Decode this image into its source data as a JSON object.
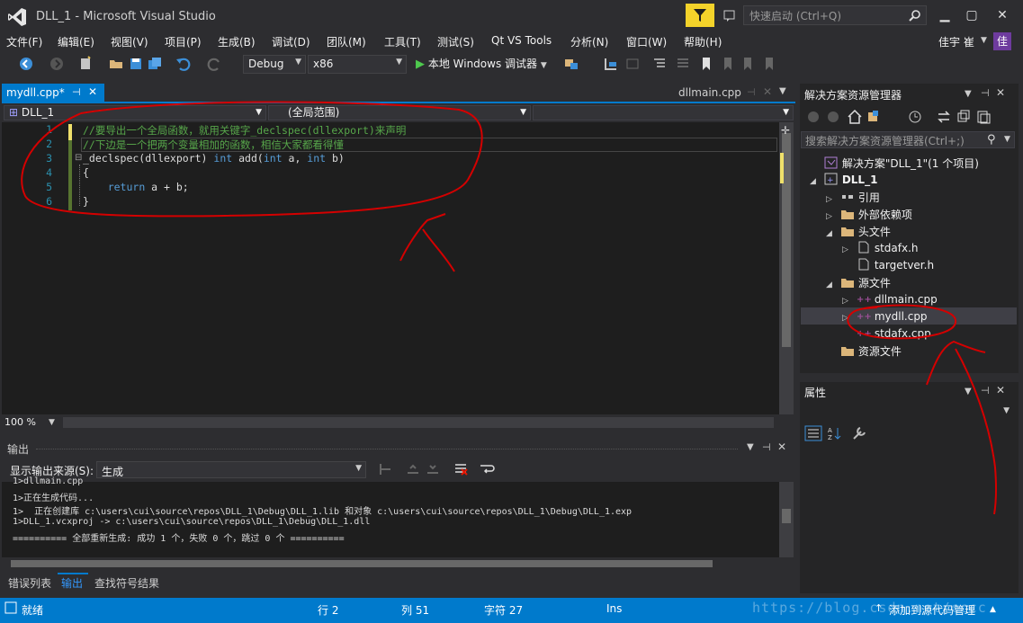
{
  "window": {
    "title": "DLL_1 - Microsoft Visual Studio",
    "quick_launch_placeholder": "快速启动 (Ctrl+Q)",
    "user_name": "佳宇 崔",
    "user_avatar": "佳"
  },
  "menu": [
    "文件(F)",
    "编辑(E)",
    "视图(V)",
    "项目(P)",
    "生成(B)",
    "调试(D)",
    "团队(M)",
    "工具(T)",
    "测试(S)",
    "Qt VS Tools",
    "分析(N)",
    "窗口(W)",
    "帮助(H)"
  ],
  "toolbar": {
    "config": "Debug",
    "platform": "x86",
    "run_label": "本地 Windows 调试器"
  },
  "tabs": {
    "active": "mydll.cpp*",
    "right": "dllmain.cpp"
  },
  "navbar": {
    "project": "DLL_1",
    "scope": "(全局范围)"
  },
  "editor": {
    "line_numbers": [
      "1",
      "2",
      "3",
      "4",
      "5",
      "6"
    ],
    "lines": [
      [
        {
          "c": "cm",
          "t": "//要导出一个全局函数，就用关键字_declspec(dllexport)来声明"
        }
      ],
      [
        {
          "c": "cm",
          "t": "//下边是一个把两个变量相加的函数，相信大家都看得懂"
        }
      ],
      [
        {
          "c": "tx",
          "t": "_declspec(dllexport) "
        },
        {
          "c": "kw",
          "t": "int"
        },
        {
          "c": "tx",
          "t": " add("
        },
        {
          "c": "kw",
          "t": "int"
        },
        {
          "c": "tx",
          "t": " a, "
        },
        {
          "c": "kw",
          "t": "int"
        },
        {
          "c": "tx",
          "t": " b)"
        }
      ],
      [
        {
          "c": "tx",
          "t": "{"
        }
      ],
      [
        {
          "c": "tx",
          "t": "    "
        },
        {
          "c": "kw",
          "t": "return"
        },
        {
          "c": "tx",
          "t": " a + b;"
        }
      ],
      [
        {
          "c": "tx",
          "t": "}"
        }
      ]
    ],
    "zoom": "100 %"
  },
  "output": {
    "title": "输出",
    "source_label": "显示输出来源(S):",
    "source_value": "生成",
    "lines": [
      "1>dllmain.cpp",
      "1>正在生成代码...",
      "1>  正在创建库 c:\\users\\cui\\source\\repos\\DLL_1\\Debug\\DLL_1.lib 和对象 c:\\users\\cui\\source\\repos\\DLL_1\\Debug\\DLL_1.exp",
      "1>DLL_1.vcxproj -> c:\\users\\cui\\source\\repos\\DLL_1\\Debug\\DLL_1.dll",
      "========== 全部重新生成: 成功 1 个，失败 0 个，跳过 0 个 =========="
    ]
  },
  "bottom_tabs": [
    "错误列表",
    "输出",
    "查找符号结果"
  ],
  "status": {
    "ready": "就绪",
    "line": "行 2",
    "col": "列 51",
    "char": "字符 27",
    "mode": "Ins",
    "source_control": "添加到源代码管理"
  },
  "solution_explorer": {
    "title": "解决方案资源管理器",
    "search_placeholder": "搜索解决方案资源管理器(Ctrl+;)",
    "tree": [
      {
        "label": "解决方案\"DLL_1\"(1 个项目)",
        "depth": 0,
        "exp": "",
        "icon": "solution"
      },
      {
        "label": "DLL_1",
        "depth": 0,
        "exp": "open",
        "icon": "project",
        "bold": true
      },
      {
        "label": "引用",
        "depth": 1,
        "exp": "closed",
        "icon": "refs"
      },
      {
        "label": "外部依赖项",
        "depth": 1,
        "exp": "closed",
        "icon": "folder"
      },
      {
        "label": "头文件",
        "depth": 1,
        "exp": "open",
        "icon": "folder"
      },
      {
        "label": "stdafx.h",
        "depth": 2,
        "exp": "closed",
        "icon": "file"
      },
      {
        "label": "targetver.h",
        "depth": 2,
        "exp": "",
        "icon": "file"
      },
      {
        "label": "源文件",
        "depth": 1,
        "exp": "open",
        "icon": "folder"
      },
      {
        "label": "dllmain.cpp",
        "depth": 2,
        "exp": "closed",
        "icon": "cpp"
      },
      {
        "label": "mydll.cpp",
        "depth": 2,
        "exp": "closed",
        "icon": "cpp"
      },
      {
        "label": "stdafx.cpp",
        "depth": 2,
        "exp": "",
        "icon": "cpp"
      },
      {
        "label": "资源文件",
        "depth": 1,
        "exp": "",
        "icon": "folder"
      }
    ]
  },
  "properties": {
    "title": "属性"
  },
  "watermark": "https://blog.csdn.net/cccc",
  "colors": {
    "accent": "#007acc",
    "background": "#2d2d30",
    "editor_bg": "#1e1e1e",
    "annotation": "#cc0000"
  }
}
